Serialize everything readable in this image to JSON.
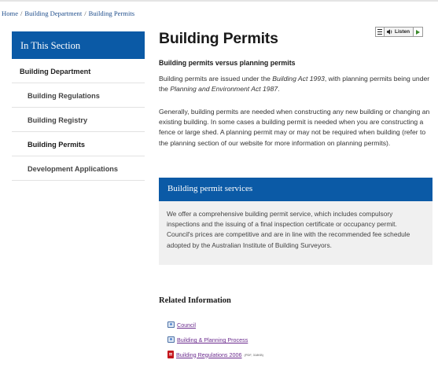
{
  "breadcrumb": {
    "items": [
      "Home",
      "Building Department",
      "Building Permits"
    ],
    "separator": "/"
  },
  "sidebar": {
    "heading": "In This Section",
    "items": [
      {
        "label": "Building Department"
      },
      {
        "label": "Building Regulations"
      },
      {
        "label": "Building Registry"
      },
      {
        "label": "Building Permits"
      },
      {
        "label": "Development Applications"
      }
    ]
  },
  "listen_widget": {
    "label": "Listen",
    "icons": [
      "menu-icon",
      "speaker-icon",
      "play-icon"
    ]
  },
  "main": {
    "title": "Building Permits",
    "subheading": "Building permits versus planning permits",
    "para1": {
      "part1": "Building permits are issued under the ",
      "act1": "Building Act 1993",
      "part2": ", with planning permits being under the ",
      "act2": "Planning and Environment Act 1987",
      "part3": "."
    },
    "para2": "Generally, building permits are needed when constructing any new building or changing an existing building. In some cases a building permit is needed when you are constructing a fence or large shed. A planning permit may or may not be required when building (refer to the planning section of our website for more information on planning permits).",
    "service_box": {
      "heading": "Building permit services",
      "text": "We offer a comprehensive building permit service, which includes compulsory inspections and the issuing of a final inspection certificate or occupancy permit. Council's prices are competitive and are in line with the recommended fee schedule adopted by the Australian Institute of Building Surveyors."
    }
  },
  "related": {
    "title": "Related Information",
    "links": [
      {
        "label": "Council",
        "icon": "web-link-icon"
      },
      {
        "label": "Building & Planning Process",
        "icon": "web-link-icon"
      },
      {
        "label": "Building Regulations 2006",
        "icon": "pdf-icon",
        "meta": "(PDF, 318KB)"
      }
    ]
  },
  "colors": {
    "brand_blue": "#0b5aa6",
    "link_visited": "#6b2b8e",
    "box_bg": "#f0f0f0"
  }
}
